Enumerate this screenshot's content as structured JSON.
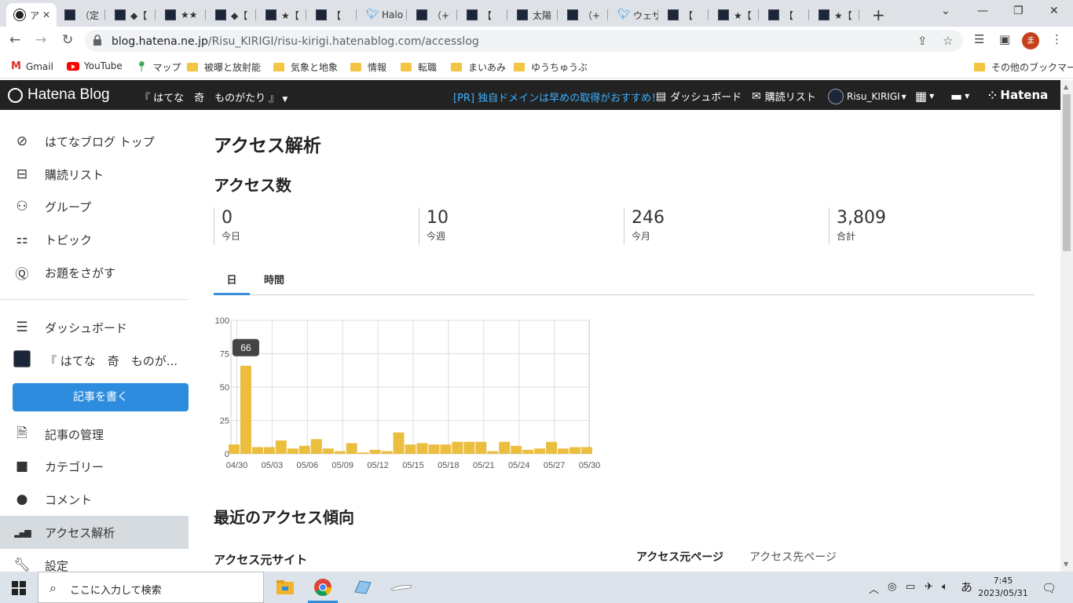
{
  "browser": {
    "tabs": [
      {
        "label": "ア",
        "icon": "hatena"
      },
      {
        "label": "（定",
        "icon": "dark"
      },
      {
        "label": "◆【",
        "icon": "dark"
      },
      {
        "label": "★★",
        "icon": "dark"
      },
      {
        "label": "◆【",
        "icon": "dark"
      },
      {
        "label": "★【",
        "icon": "dark"
      },
      {
        "label": "【 ",
        "icon": "dark"
      },
      {
        "label": "Halo",
        "icon": "twitter"
      },
      {
        "label": "（+",
        "icon": "dark"
      },
      {
        "label": "【 ",
        "icon": "dark"
      },
      {
        "label": "太陽",
        "icon": "dark"
      },
      {
        "label": "（+",
        "icon": "dark"
      },
      {
        "label": "ウェザ",
        "icon": "twitter"
      },
      {
        "label": "【 ",
        "icon": "dark"
      },
      {
        "label": "★【",
        "icon": "dark"
      },
      {
        "label": "【 ",
        "icon": "dark"
      },
      {
        "label": "★【",
        "icon": "dark"
      }
    ],
    "url_host": "blog.hatena.ne.jp",
    "url_path": "/Risu_KIRIGI/risu-kirigi.hatenablog.com/accesslog",
    "profile_initial": "ま"
  },
  "bookmarks": [
    {
      "label": "Gmail",
      "type": "gmail"
    },
    {
      "label": "YouTube",
      "type": "youtube"
    },
    {
      "label": "マップ",
      "type": "maps"
    },
    {
      "label": "被曝と放射能",
      "type": "folder"
    },
    {
      "label": "気象と地象",
      "type": "folder"
    },
    {
      "label": "情報",
      "type": "folder"
    },
    {
      "label": "転職",
      "type": "folder"
    },
    {
      "label": "まいあみ",
      "type": "folder"
    },
    {
      "label": "ゆうちゅうぶ",
      "type": "folder"
    }
  ],
  "bookmarks_other": "その他のブックマーク",
  "hatena_bar": {
    "logo": "Hatena Blog",
    "blog_name": "『 はてな　奇　ものがたり 』",
    "pr": "[PR] 独自ドメインは早めの取得がおすすめ！",
    "dashboard": "ダッシュボード",
    "subscriptions": "購読リスト",
    "user": "Risu_KIRIGI",
    "hatena": "Hatena"
  },
  "sidebar": {
    "items_top": [
      {
        "label": "はてなブログ トップ",
        "icon": "compass"
      },
      {
        "label": "購読リスト",
        "icon": "inbox"
      },
      {
        "label": "グループ",
        "icon": "group"
      },
      {
        "label": "トピック",
        "icon": "topic"
      },
      {
        "label": "お題をさがす",
        "icon": "search"
      }
    ],
    "items_bottom": [
      {
        "label": "ダッシュボード",
        "icon": "dashboard"
      },
      {
        "label": "『 はてな　奇　ものが...",
        "icon": "blog"
      }
    ],
    "write_button": "記事を書く",
    "items_manage": [
      {
        "label": "記事の管理",
        "icon": "document"
      },
      {
        "label": "カテゴリー",
        "icon": "folder"
      },
      {
        "label": "コメント",
        "icon": "comment"
      },
      {
        "label": "アクセス解析",
        "icon": "bars"
      },
      {
        "label": "設定",
        "icon": "wrench"
      }
    ]
  },
  "main": {
    "title": "アクセス解析",
    "section": "アクセス数",
    "stats": [
      {
        "value": "0",
        "label": "今日"
      },
      {
        "value": "10",
        "label": "今週"
      },
      {
        "value": "246",
        "label": "今月"
      },
      {
        "value": "3,809",
        "label": "合計"
      }
    ],
    "tabs": [
      "日",
      "時間"
    ],
    "recent_title": "最近のアクセス傾向",
    "ref_site": "アクセス元サイト",
    "ref_page": "アクセス元ページ",
    "dest_page": "アクセス先ページ"
  },
  "chart_data": {
    "type": "bar",
    "categories": [
      "04/30",
      "05/01",
      "05/02",
      "05/03",
      "05/04",
      "05/05",
      "05/06",
      "05/07",
      "05/08",
      "05/09",
      "05/10",
      "05/11",
      "05/12",
      "05/13",
      "05/14",
      "05/15",
      "05/16",
      "05/17",
      "05/18",
      "05/19",
      "05/20",
      "05/21",
      "05/22",
      "05/23",
      "05/24",
      "05/25",
      "05/26",
      "05/27",
      "05/28",
      "05/29",
      "05/30"
    ],
    "values": [
      7,
      66,
      5,
      5,
      10,
      4,
      6,
      11,
      4,
      2,
      8,
      1,
      3,
      2,
      16,
      7,
      8,
      7,
      7,
      9,
      9,
      9,
      2,
      9,
      6,
      3,
      4,
      9,
      4,
      5,
      5
    ],
    "tick_labels": [
      "04/30",
      "05/03",
      "05/06",
      "05/09",
      "05/12",
      "05/15",
      "05/18",
      "05/21",
      "05/24",
      "05/27",
      "05/30"
    ],
    "yticks": [
      0,
      25,
      50,
      75,
      100
    ],
    "ylim": [
      0,
      100
    ],
    "tooltip": "66",
    "bar_color": "#ebbe3f",
    "grid": true
  },
  "taskbar": {
    "search_placeholder": "ここに入力して検索",
    "ime": "あ",
    "time": "7:45",
    "date": "2023/05/31"
  }
}
